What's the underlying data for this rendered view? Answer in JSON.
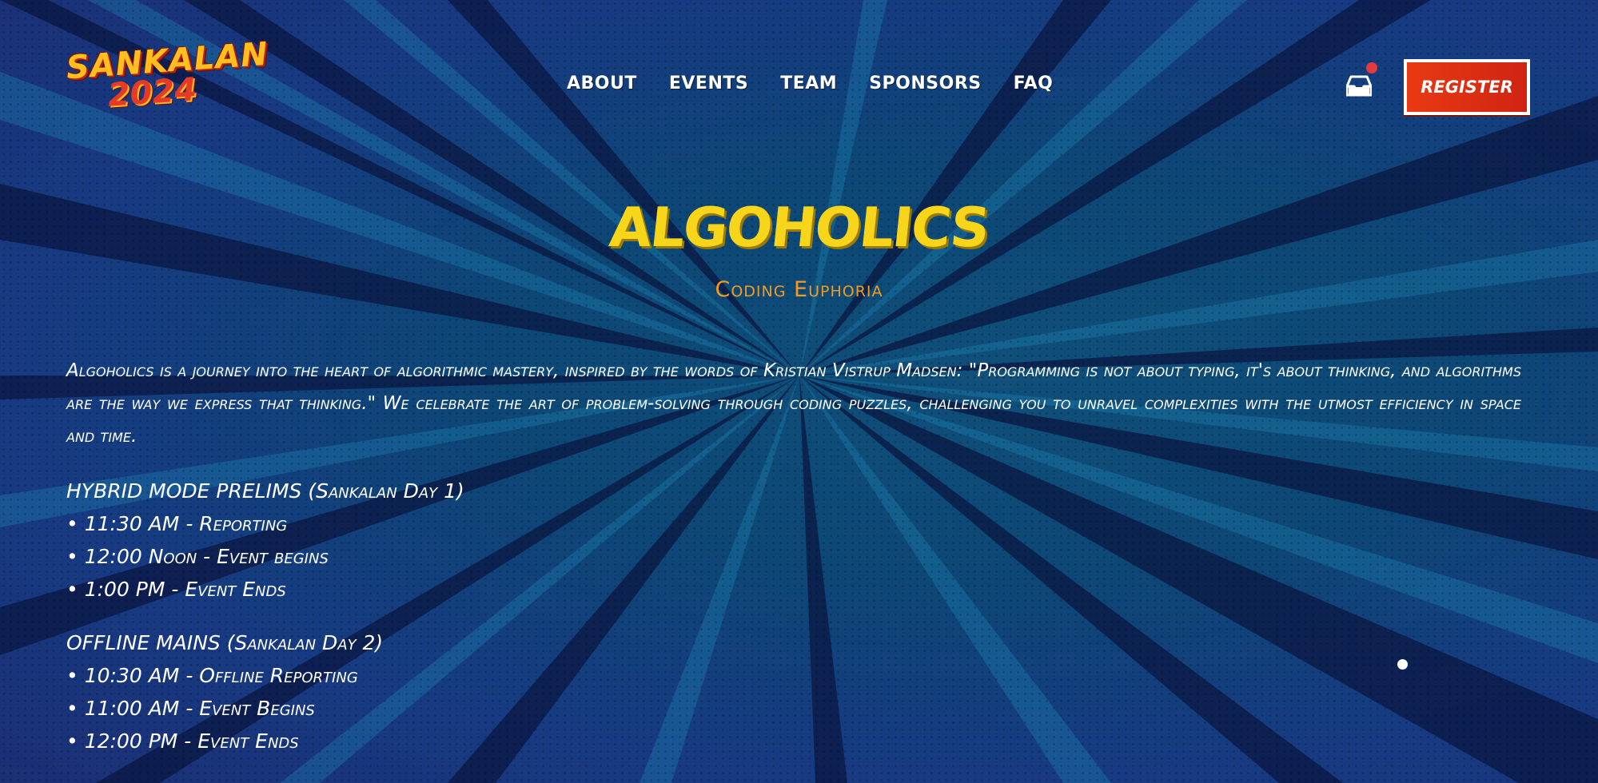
{
  "logo": {
    "line1": "SANKALAN",
    "line2": "2024"
  },
  "nav": {
    "items": [
      {
        "label": "ABOUT"
      },
      {
        "label": "EVENTS"
      },
      {
        "label": "TEAM"
      },
      {
        "label": "SPONSORS"
      },
      {
        "label": "FAQ"
      }
    ]
  },
  "header": {
    "inbox_icon": "inbox-icon",
    "notification_color": "#e63a3a",
    "register_label": "REGISTER",
    "register_color": "#d92b13"
  },
  "event": {
    "title": "ALGOHOLICS",
    "subtitle": "Coding Euphoria",
    "description": "Algoholics is a journey into the heart of algorithmic mastery, inspired by the words of Kristian Vistrup Madsen: \"Programming is not about typing, it's about thinking, and algorithms are the way we express that thinking.\" We celebrate the art of problem-solving through coding puzzles, challenging you to unravel complexities with the utmost efficiency in space and time."
  },
  "schedule": [
    {
      "heading": "HYBRID MODE PRELIMS (Sankalan Day 1)",
      "items": [
        "11:30 AM - Reporting",
        "12:00 Noon - Event begins",
        "1:00 PM - Event Ends"
      ]
    },
    {
      "heading": "OFFLINE MAINS (Sankalan Day 2)",
      "items": [
        "10:30 AM - Offline Reporting",
        "11:00 AM - Event Begins",
        "12:00 PM - Event Ends"
      ]
    }
  ],
  "colors": {
    "title": "#f7d51a",
    "subtitle": "#f49b1e",
    "background": "#0d4776"
  }
}
